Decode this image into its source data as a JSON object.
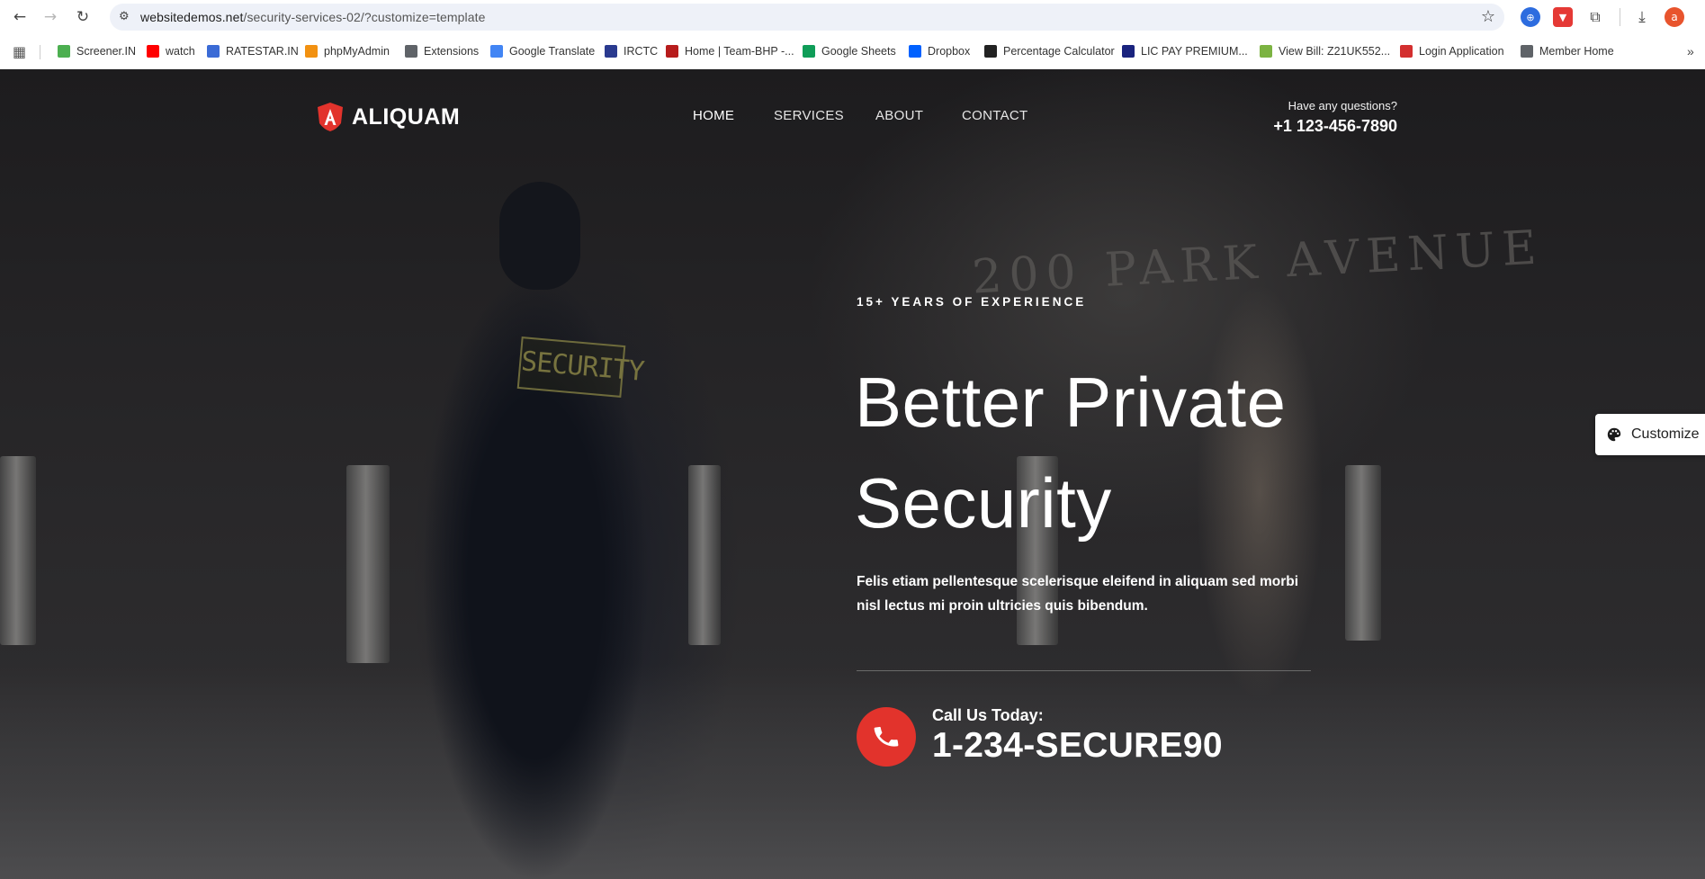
{
  "browser": {
    "url_host": "websitedemos.net",
    "url_path": "/security-services-02/?customize=template",
    "profile_initial": "a"
  },
  "bookmarks": [
    {
      "label": "Screener.IN",
      "icon": "bar-chart-icon",
      "color": "#4caf50"
    },
    {
      "label": "watch",
      "icon": "youtube-icon",
      "color": "#ff0000"
    },
    {
      "label": "RATESTAR.IN",
      "icon": "ratestar-icon",
      "color": "#3b6bd6"
    },
    {
      "label": "phpMyAdmin",
      "icon": "phpmyadmin-icon",
      "color": "#f29111"
    },
    {
      "label": "Extensions",
      "icon": "puzzle-icon",
      "color": "#5f6368"
    },
    {
      "label": "Google Translate",
      "icon": "translate-icon",
      "color": "#4285f4"
    },
    {
      "label": "IRCTC",
      "icon": "irctc-icon",
      "color": "#2a3a8f"
    },
    {
      "label": "Home | Team-BHP -...",
      "icon": "teambhp-icon",
      "color": "#b71c1c"
    },
    {
      "label": "Google Sheets",
      "icon": "sheets-icon",
      "color": "#0f9d58"
    },
    {
      "label": "Dropbox",
      "icon": "dropbox-icon",
      "color": "#0061ff"
    },
    {
      "label": "Percentage Calculator",
      "icon": "percent-icon",
      "color": "#222222"
    },
    {
      "label": "LIC PAY PREMIUM...",
      "icon": "lic-icon",
      "color": "#1a237e"
    },
    {
      "label": "View Bill: Z21UK552...",
      "icon": "bill-icon",
      "color": "#7cb342"
    },
    {
      "label": "Login Application",
      "icon": "login-icon",
      "color": "#d32f2f"
    },
    {
      "label": "Member Home",
      "icon": "globe-icon",
      "color": "#5f6368"
    }
  ],
  "site": {
    "brand": "ALIQUAM",
    "brand_icon": "shield-a-icon",
    "nav": [
      "HOME",
      "SERVICES",
      "ABOUT",
      "CONTACT"
    ],
    "questions_label": "Have any questions?",
    "questions_phone": "+1 123-456-7890"
  },
  "hero": {
    "eyebrow": "15+ YEARS OF EXPERIENCE",
    "headline_line1": "Better Private",
    "headline_line2": "Security",
    "description": "Felis etiam pellentesque scelerisque eleifend in aliquam sed morbi nisl lectus mi proin ultricies quis bibendum.",
    "call_label": "Call Us Today:",
    "call_number": "1-234-SECURE90",
    "background_sign": "200 PARK AVENUE",
    "patch_text": "SECURITY"
  },
  "customize_label": "Customize",
  "colors": {
    "accent": "#e2332c",
    "bg": "#1b1a1c"
  }
}
